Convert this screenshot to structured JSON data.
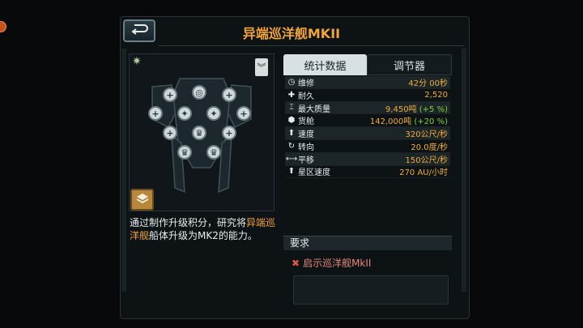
{
  "header": {
    "title": "异端巡洋舰MKII",
    "back_icon": "return-arrow-icon"
  },
  "ship": {
    "star_icon": "star-icon",
    "collapse_icon": "chevron-down-icon",
    "modules": [
      {
        "name": "module-heal-1",
        "glyph": "+"
      },
      {
        "name": "module-target",
        "glyph": "◎"
      },
      {
        "name": "module-heal-2",
        "glyph": "+"
      },
      {
        "name": "module-heal-3",
        "glyph": "+"
      },
      {
        "name": "module-star-1",
        "glyph": "✦"
      },
      {
        "name": "module-star-2",
        "glyph": "✦"
      },
      {
        "name": "module-heal-4",
        "glyph": "+"
      },
      {
        "name": "module-heal-5",
        "glyph": "+"
      },
      {
        "name": "module-crown-1",
        "glyph": "♛"
      },
      {
        "name": "module-heal-6",
        "glyph": "+"
      },
      {
        "name": "module-crown-2",
        "glyph": "♛"
      },
      {
        "name": "module-crown-3",
        "glyph": "♛"
      }
    ],
    "layer_icon": "layers-icon"
  },
  "description": {
    "prefix": "通过制作升级积分，研究将",
    "highlight": "异端巡洋舰",
    "suffix": "船体升级为MK2的能力。"
  },
  "tabs": [
    {
      "label": "统计数据",
      "active": true
    },
    {
      "label": "调节器",
      "active": false
    }
  ],
  "stats": [
    {
      "icon": "clock-icon",
      "glyph": "◷",
      "label": "维修",
      "value": "42分 00秒",
      "bonus": "",
      "tail": ""
    },
    {
      "icon": "plus-icon",
      "glyph": "✚",
      "label": "耐久",
      "value": "2,520",
      "bonus": "",
      "tail": ""
    },
    {
      "icon": "weight-icon",
      "glyph": "⌶",
      "label": "最大质量",
      "value": "9,450吨",
      "bonus": " (+5 %)",
      "tail": ""
    },
    {
      "icon": "cargo-icon",
      "glyph": "⬢",
      "label": "货舱",
      "value": "142,000吨",
      "bonus": " (+20 %)",
      "tail": ""
    },
    {
      "icon": "speed-arrow-icon",
      "glyph": "⬆",
      "label": "速度",
      "value": "320公尺/秒",
      "bonus": "",
      "tail": ""
    },
    {
      "icon": "rotate-icon",
      "glyph": "↻",
      "label": "转向",
      "value": "20.0度/秒",
      "bonus": "",
      "tail": ""
    },
    {
      "icon": "strafe-icon",
      "glyph": "⟷",
      "label": "平移",
      "value": "150公尺/秒",
      "bonus": "",
      "tail": ""
    },
    {
      "icon": "warp-arrow-icon",
      "glyph": "⬆",
      "label": "星区速度",
      "value": "270 AU/小时",
      "bonus": "",
      "tail": ""
    }
  ],
  "requirements": {
    "header": "要求",
    "items": [
      {
        "label": "启示巡洋舰MkII",
        "met": false
      }
    ]
  },
  "colors": {
    "accent": "#f2a33a",
    "bonus": "#7fd13a",
    "unmet": "#e25442"
  }
}
